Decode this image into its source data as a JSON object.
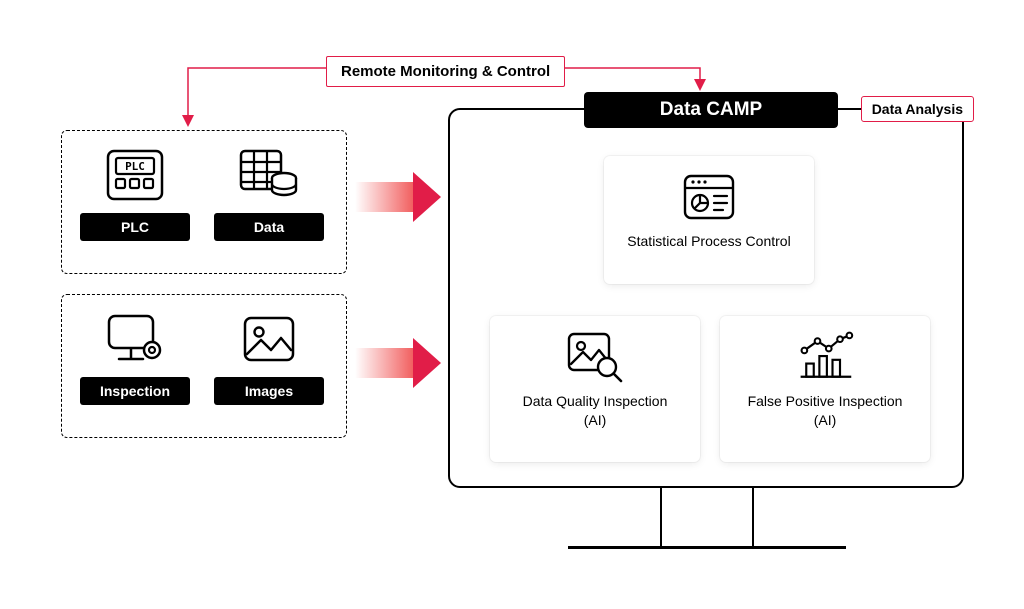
{
  "top_label": "Remote Monitoring & Control",
  "sources": {
    "row1": [
      {
        "name": "plc",
        "label": "PLC"
      },
      {
        "name": "data",
        "label": "Data"
      }
    ],
    "row2": [
      {
        "name": "inspection",
        "label": "Inspection"
      },
      {
        "name": "images",
        "label": "Images"
      }
    ]
  },
  "monitor": {
    "title": "Data CAMP",
    "tab": "Data Analysis",
    "cards": {
      "spc": "Statistical Process Control",
      "dqi": "Data Quality Inspection\n(AI)",
      "fpi": "False Positive Inspection\n(AI)"
    }
  }
}
